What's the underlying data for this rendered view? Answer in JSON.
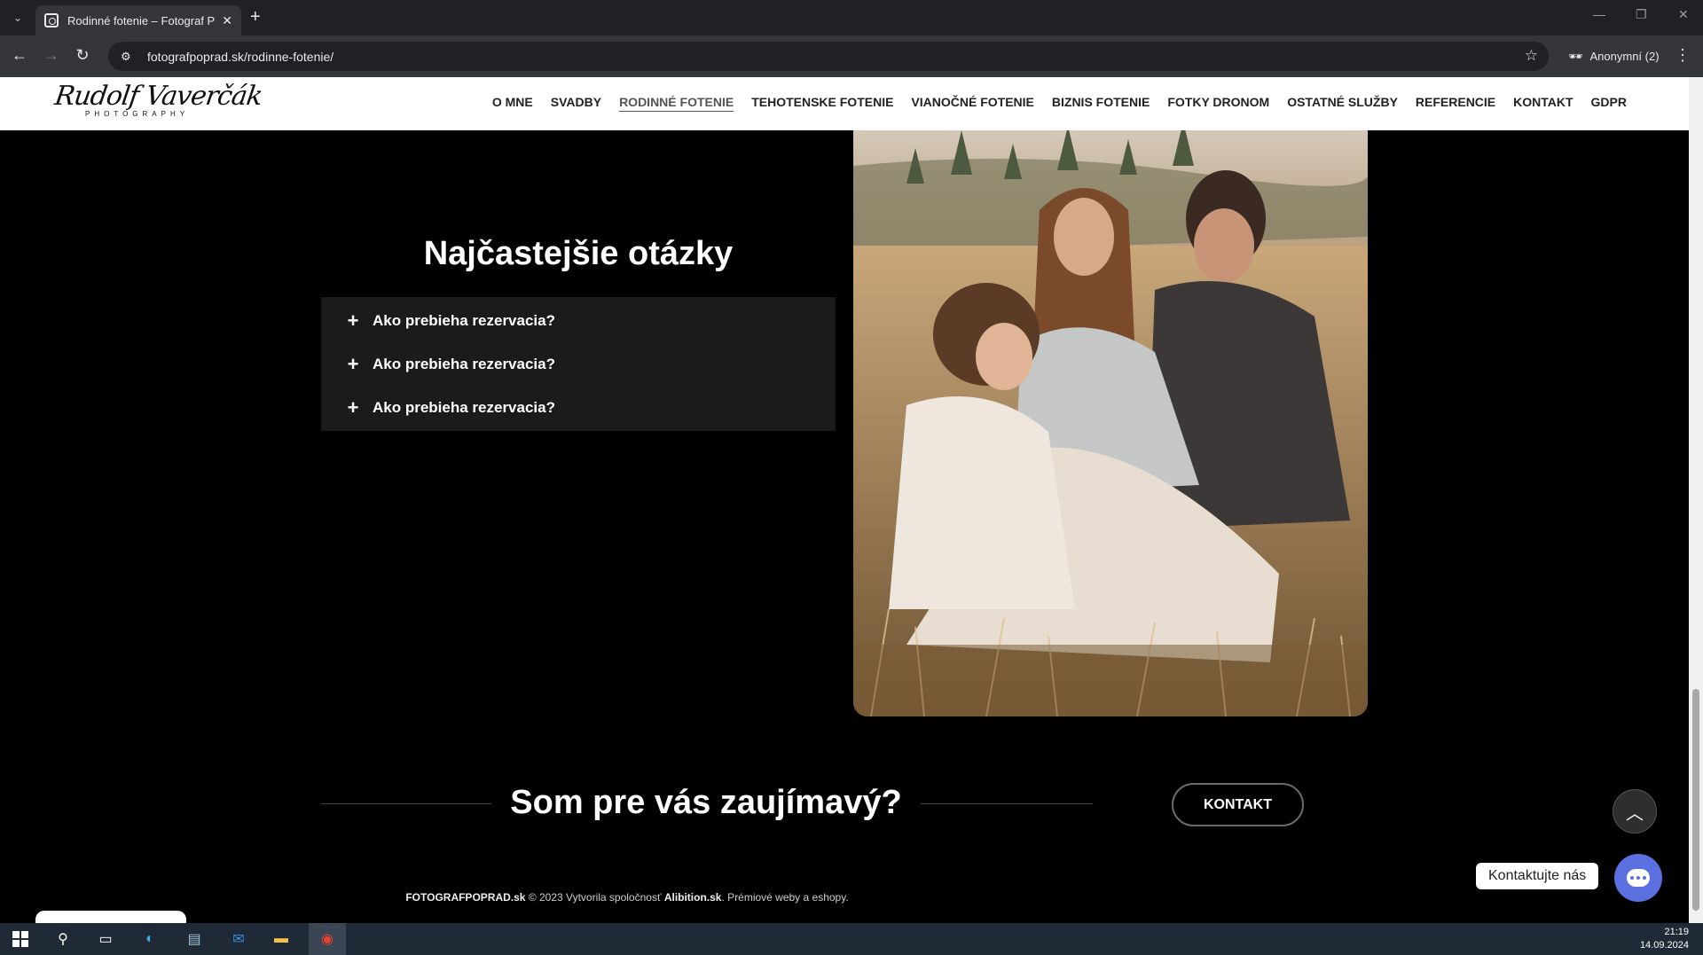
{
  "browser": {
    "tab_title": "Rodinné fotenie – Fotograf Pop",
    "url": "fotografpoprad.sk/rodinne-fotenie/",
    "profile_label": "Anonymní (2)"
  },
  "site": {
    "logo_signature": "Rudolf Vaverčák",
    "logo_sub": "PHOTOGRAPHY",
    "menu": [
      {
        "label": "O MNE"
      },
      {
        "label": "SVADBY"
      },
      {
        "label": "RODINNÉ FOTENIE",
        "active": true
      },
      {
        "label": "TEHOTENSKE FOTENIE"
      },
      {
        "label": "VIANOČNÉ FOTENIE"
      },
      {
        "label": "BIZNIS FOTENIE"
      },
      {
        "label": "FOTKY DRONOM"
      },
      {
        "label": "OSTATNÉ SLUŽBY"
      },
      {
        "label": "REFERENCIE"
      },
      {
        "label": "KONTAKT"
      },
      {
        "label": "GDPR"
      }
    ]
  },
  "faq": {
    "title": "Najčastejšie otázky",
    "items": [
      {
        "question": "Ako prebieha rezervacia?"
      },
      {
        "question": "Ako prebieha rezervacia?"
      },
      {
        "question": "Ako prebieha rezervacia?"
      }
    ]
  },
  "cta": {
    "heading": "Som pre vás zaujímavý?",
    "button": "KONTAKT"
  },
  "footer": {
    "brand": "FOTOGRAFPOPRAD.sk",
    "copyright": "© 2023 Vytvorila spoločnosť",
    "company": "Alibition.sk",
    "tagline": ". Prémiové weby a eshopy."
  },
  "chat": {
    "label": "Kontaktujte nás"
  },
  "taskbar": {
    "time": "21:19",
    "date": "14.09.2024"
  }
}
